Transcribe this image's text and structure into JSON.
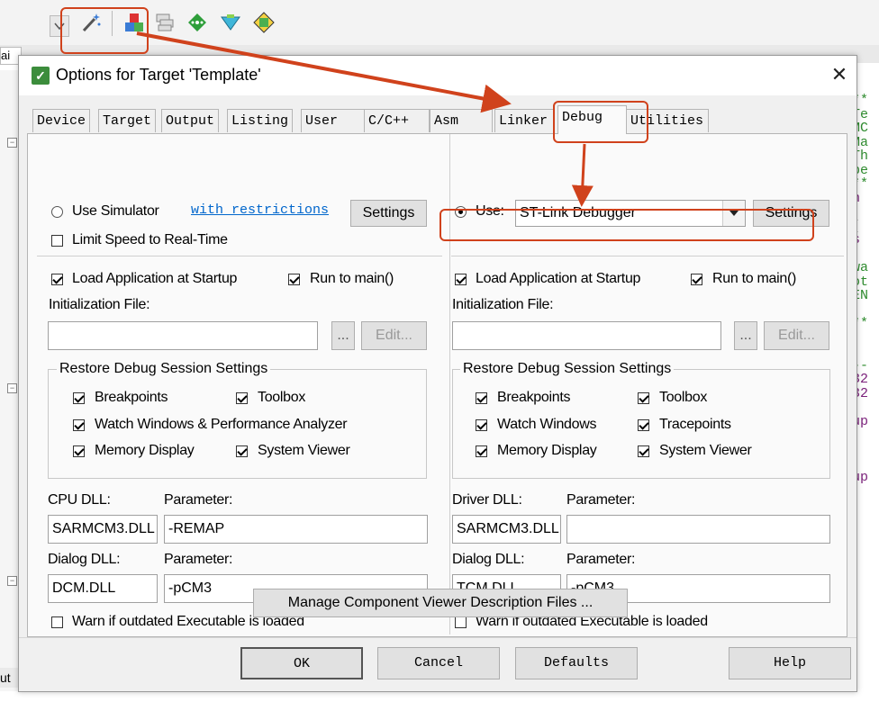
{
  "background": {
    "code_lines": [
      "**",
      "Te",
      "MC",
      "Ma",
      "Th",
      "pe",
      "**",
      "n",
      "",
      "(",
      "s",
      "",
      "wa",
      "ot",
      "EN",
      "",
      "**",
      "",
      "",
      "--",
      "32",
      "32",
      "",
      "up",
      "",
      "",
      "",
      "up"
    ],
    "tab_left": "ai",
    "bottom_left": "ut",
    "toolbar_icons": [
      "dropdown-arrow-icon",
      "magic-wand-icon",
      "target-options-icon",
      "layers-icon",
      "green-diamond-icon",
      "download-icon",
      "pack-installer-icon"
    ]
  },
  "dialog": {
    "title": "Options for Target 'Template'",
    "close": "✕",
    "tabs": [
      "Device",
      "Target",
      "Output",
      "Listing",
      "User",
      "C/C++",
      "Asm",
      "Linker",
      "Debug",
      "Utilities"
    ],
    "active_tab": "Debug",
    "left": {
      "use_simulator": "Use Simulator",
      "with_restrictions": "with restrictions",
      "settings": "Settings",
      "limit_speed": "Limit Speed to Real-Time",
      "load_app": "Load Application at Startup",
      "run_to_main": "Run to main()",
      "init_file_label": "Initialization File:",
      "init_file_value": "",
      "browse": "...",
      "edit": "Edit...",
      "restore_title": "Restore Debug Session Settings",
      "breakpoints": "Breakpoints",
      "toolbox": "Toolbox",
      "watch_windows": "Watch Windows & Performance Analyzer",
      "memory_display": "Memory Display",
      "system_viewer": "System Viewer",
      "cpu_dll_label": "CPU DLL:",
      "parameter_label": "Parameter:",
      "cpu_dll_value": "SARMCM3.DLL",
      "cpu_param_value": "-REMAP",
      "dialog_dll_label": "Dialog DLL:",
      "dialog_dll_value": "DCM.DLL",
      "dialog_param_value": "-pCM3",
      "warn_outdated": "Warn if outdated Executable is loaded"
    },
    "right": {
      "use_label": "Use:",
      "debugger": "ST-Link Debugger",
      "settings": "Settings",
      "load_app": "Load Application at Startup",
      "run_to_main": "Run to main()",
      "init_file_label": "Initialization File:",
      "init_file_value": "",
      "browse": "...",
      "edit": "Edit...",
      "restore_title": "Restore Debug Session Settings",
      "breakpoints": "Breakpoints",
      "toolbox": "Toolbox",
      "watch_windows": "Watch Windows",
      "tracepoints": "Tracepoints",
      "memory_display": "Memory Display",
      "system_viewer": "System Viewer",
      "driver_dll_label": "Driver DLL:",
      "parameter_label": "Parameter:",
      "driver_dll_value": "SARMCM3.DLL",
      "driver_param_value": "",
      "dialog_dll_label": "Dialog DLL:",
      "dialog_dll_value": "TCM.DLL",
      "dialog_param_value": "-pCM3",
      "warn_outdated": "Warn if outdated Executable is loaded"
    },
    "manage_button": "Manage Component Viewer Description Files ...",
    "footer": {
      "ok": "OK",
      "cancel": "Cancel",
      "defaults": "Defaults",
      "help": "Help"
    }
  },
  "annotation_color": "#d0421c"
}
